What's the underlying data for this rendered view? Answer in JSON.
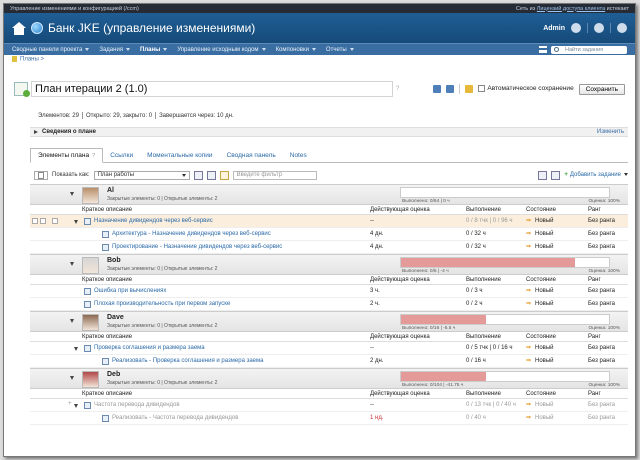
{
  "top": {
    "left": "Управление изменениями и конфигурацией (/ccm)",
    "right_prefix": "Сеть из",
    "right_link": "Лицензий доступа клиента",
    "right_suffix": "истекает"
  },
  "header": {
    "title": "Банк JKE (управление изменениями)",
    "user": "Admin"
  },
  "nav": {
    "items": [
      "Сводные панели проекта",
      "Задания",
      "Планы",
      "Управление исходным кодом",
      "Компоновки",
      "Отчеты"
    ],
    "active_index": 2,
    "search_placeholder": "Найти задания"
  },
  "breadcrumb": "Планы >",
  "plan": {
    "title": "План итерации 2 (1.0)",
    "help": "?",
    "autosave": "Автоматическое сохранение",
    "save": "Сохранить"
  },
  "stats": {
    "elements": "Элементов: 29",
    "open": "Открыто: 29, закрыто: 0",
    "ends": "Завершается через: 10 дн."
  },
  "info": {
    "label": "Сведения о плане",
    "change": "Изменить"
  },
  "tabs": [
    {
      "label": "Элементы плана",
      "help": "?"
    },
    {
      "label": "Ссылки"
    },
    {
      "label": "Моментальные копии"
    },
    {
      "label": "Сводная панель"
    },
    {
      "label": "Notes"
    }
  ],
  "viewbar": {
    "show_as": "Показать как:",
    "view": "План работы",
    "filter_placeholder": "Введите фильтр",
    "add": "Добавить задание"
  },
  "columns": {
    "desc": "Краткое описание",
    "estimate": "Действующая оценка",
    "done": "Выполнение",
    "state": "Состояние",
    "rank": "Ранг"
  },
  "owners": [
    {
      "name": "Al",
      "sub": "Закрытые элементы: 0 | Открытые элементы: 2",
      "progress_label": "Выполнено: 0/64 | 0 ч",
      "progress_fraction": 0,
      "score": "Оценка: 100%",
      "rows": [
        {
          "level": 0,
          "tri": true,
          "desc": "Назначение дивидендов через веб-сервис",
          "estimate": "--",
          "done": "0 / 8 тчк | 0 / 96 ч",
          "state": "Новый",
          "rank": "Без ранга",
          "hl": true
        },
        {
          "level": 1,
          "desc": "Архитектура - Назначение дивидендов через веб-сервис",
          "estimate": "4 дн.",
          "done": "0 / 32 ч",
          "state": "Новый",
          "rank": "Без ранга"
        },
        {
          "level": 1,
          "desc": "Проектирование - Назначение дивидендов через веб-сервис",
          "estimate": "4 дн.",
          "done": "0 / 32 ч",
          "state": "Новый",
          "rank": "Без ранга"
        }
      ]
    },
    {
      "name": "Bob",
      "sub": "Закрытые элементы: 0 | Открытые элементы: 2",
      "progress_label": "Выполнено: 0/5 | -4 ч",
      "progress_fraction": 0.835,
      "score": "Оценка: 100%",
      "rows": [
        {
          "level": 0,
          "desc": "Ошибка при вычислениях",
          "estimate": "3 ч.",
          "done": "0 / 3 ч",
          "state": "Новый",
          "rank": "Без ранга"
        },
        {
          "level": 0,
          "desc": "Плохая производительность при первом запуске",
          "estimate": "2 ч.",
          "done": "0 / 2 ч",
          "state": "Новый",
          "rank": "Без ранга"
        }
      ]
    },
    {
      "name": "Dave",
      "sub": "Закрытые элементы: 0 | Открытые элементы: 2",
      "progress_label": "Выполнено: 0/16 | -5.5 ч",
      "progress_fraction": 0.41,
      "score": "Оценка: 100%",
      "rows": [
        {
          "level": 0,
          "tri": true,
          "desc": "Проверка соглашения и размера заема",
          "estimate": "--",
          "done": "0 / 5 тчк | 0 / 16 ч",
          "state": "Новый",
          "rank": "Без ранга"
        },
        {
          "level": 1,
          "desc": "Реализовать - Проверка соглашения и размера заема",
          "estimate": "2 дн.",
          "done": "0 / 16 ч",
          "state": "Новый",
          "rank": "Без ранга"
        }
      ]
    },
    {
      "name": "Deb",
      "sub": "Закрытые элементы: 0 | Открытые элементы: 2",
      "progress_label": "Выполнено: 0/104 | -41.75 ч",
      "progress_fraction": 0.41,
      "score": "Оценка: 100%",
      "rows": [
        {
          "level": 0,
          "tri": true,
          "desc": "Частота перевода дивидендов",
          "estimate": "--",
          "done": "0 / 13 тчк | 0 / 40 ч",
          "state": "Новый",
          "rank": "Без ранга",
          "grey": true
        },
        {
          "level": 1,
          "desc": "Реализовать - Частота перевода дивидендов",
          "estimate": "1 нд.",
          "done": "0 / 40 ч",
          "state": "Новый",
          "rank": "Без ранга",
          "grey": true,
          "est_red": true
        }
      ]
    }
  ]
}
